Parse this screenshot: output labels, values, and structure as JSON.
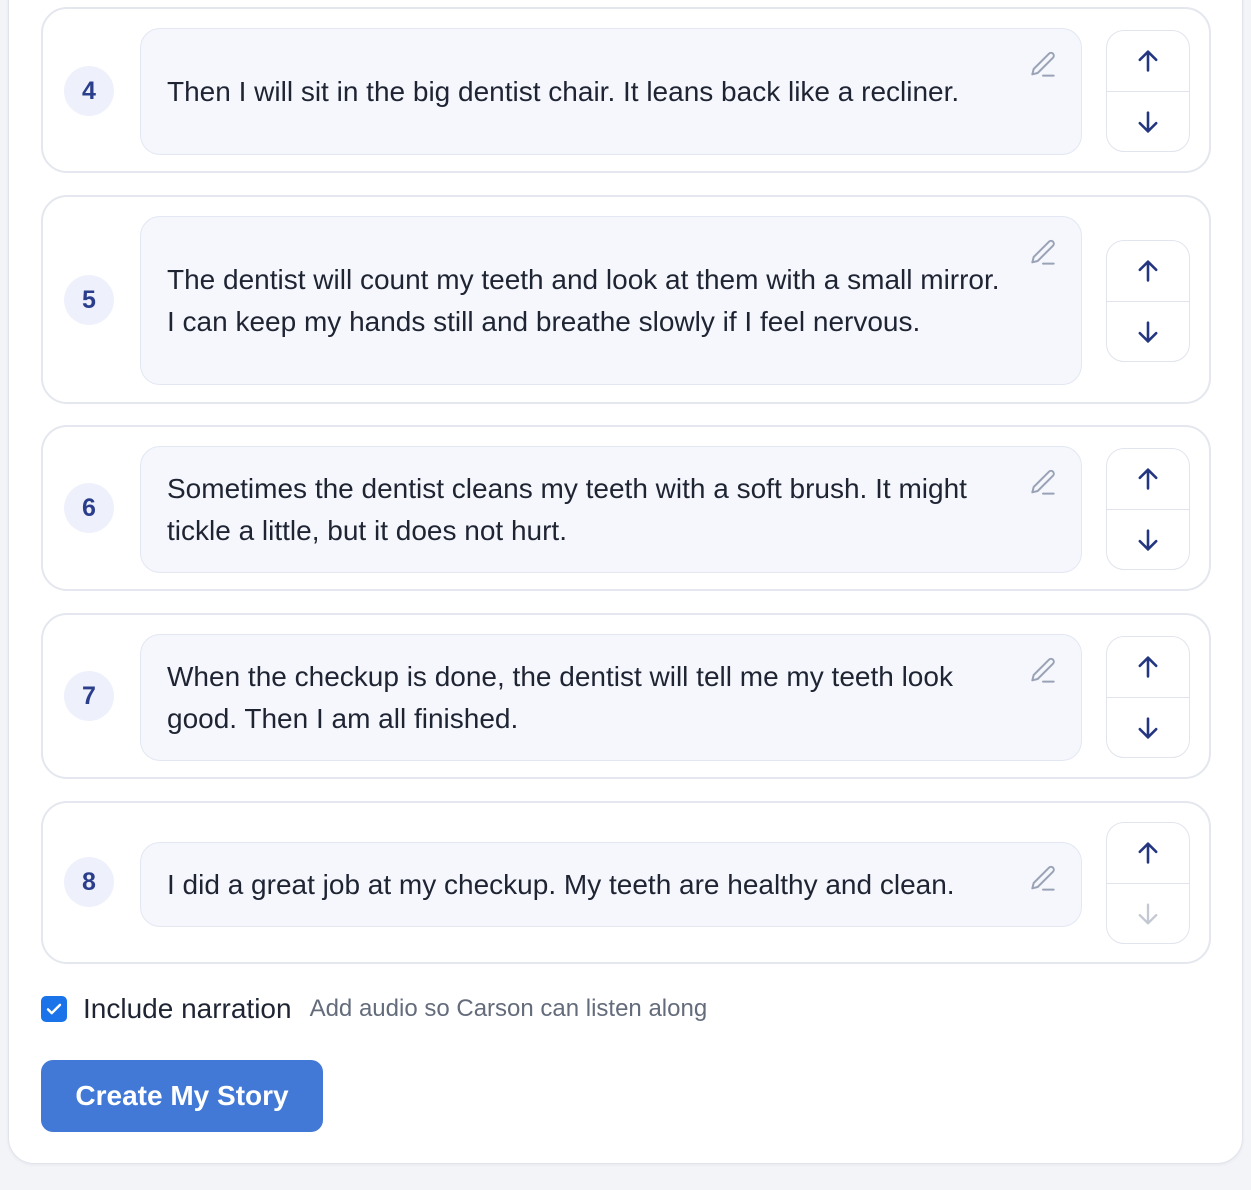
{
  "steps": [
    {
      "number": "4",
      "text": "Then I will sit in the big dentist chair. It leans back like a recliner.",
      "move_down_enabled": true
    },
    {
      "number": "5",
      "text": "The dentist will count my teeth and look at them with a small mirror. I can keep my hands still and breathe slowly if I feel nervous.",
      "move_down_enabled": true
    },
    {
      "number": "6",
      "text": "Sometimes the dentist cleans my teeth with a soft brush. It might tickle a little, but it does not hurt.",
      "move_down_enabled": true
    },
    {
      "number": "7",
      "text": "When the checkup is done, the dentist will tell me my teeth look good. Then I am all finished.",
      "move_down_enabled": true
    },
    {
      "number": "8",
      "text": "I did a great job at my checkup. My teeth are healthy and clean.",
      "move_down_enabled": false
    }
  ],
  "icons": {
    "edit": "pencil-icon",
    "move_up": "arrow-up-icon",
    "move_down": "arrow-down-icon",
    "checkbox": "checkmark-icon"
  },
  "narration": {
    "checked": true,
    "label": "Include narration",
    "hint": "Add audio so Carson can listen along"
  },
  "create_button": {
    "label": "Create My Story"
  },
  "colors": {
    "accent": "#4279d6",
    "checkbox": "#1a73e8",
    "arrow": "#23367f",
    "arrow_disabled": "#c3c8d3",
    "step_number": "#2b3e8c",
    "edit_icon": "#9aa3b6"
  }
}
